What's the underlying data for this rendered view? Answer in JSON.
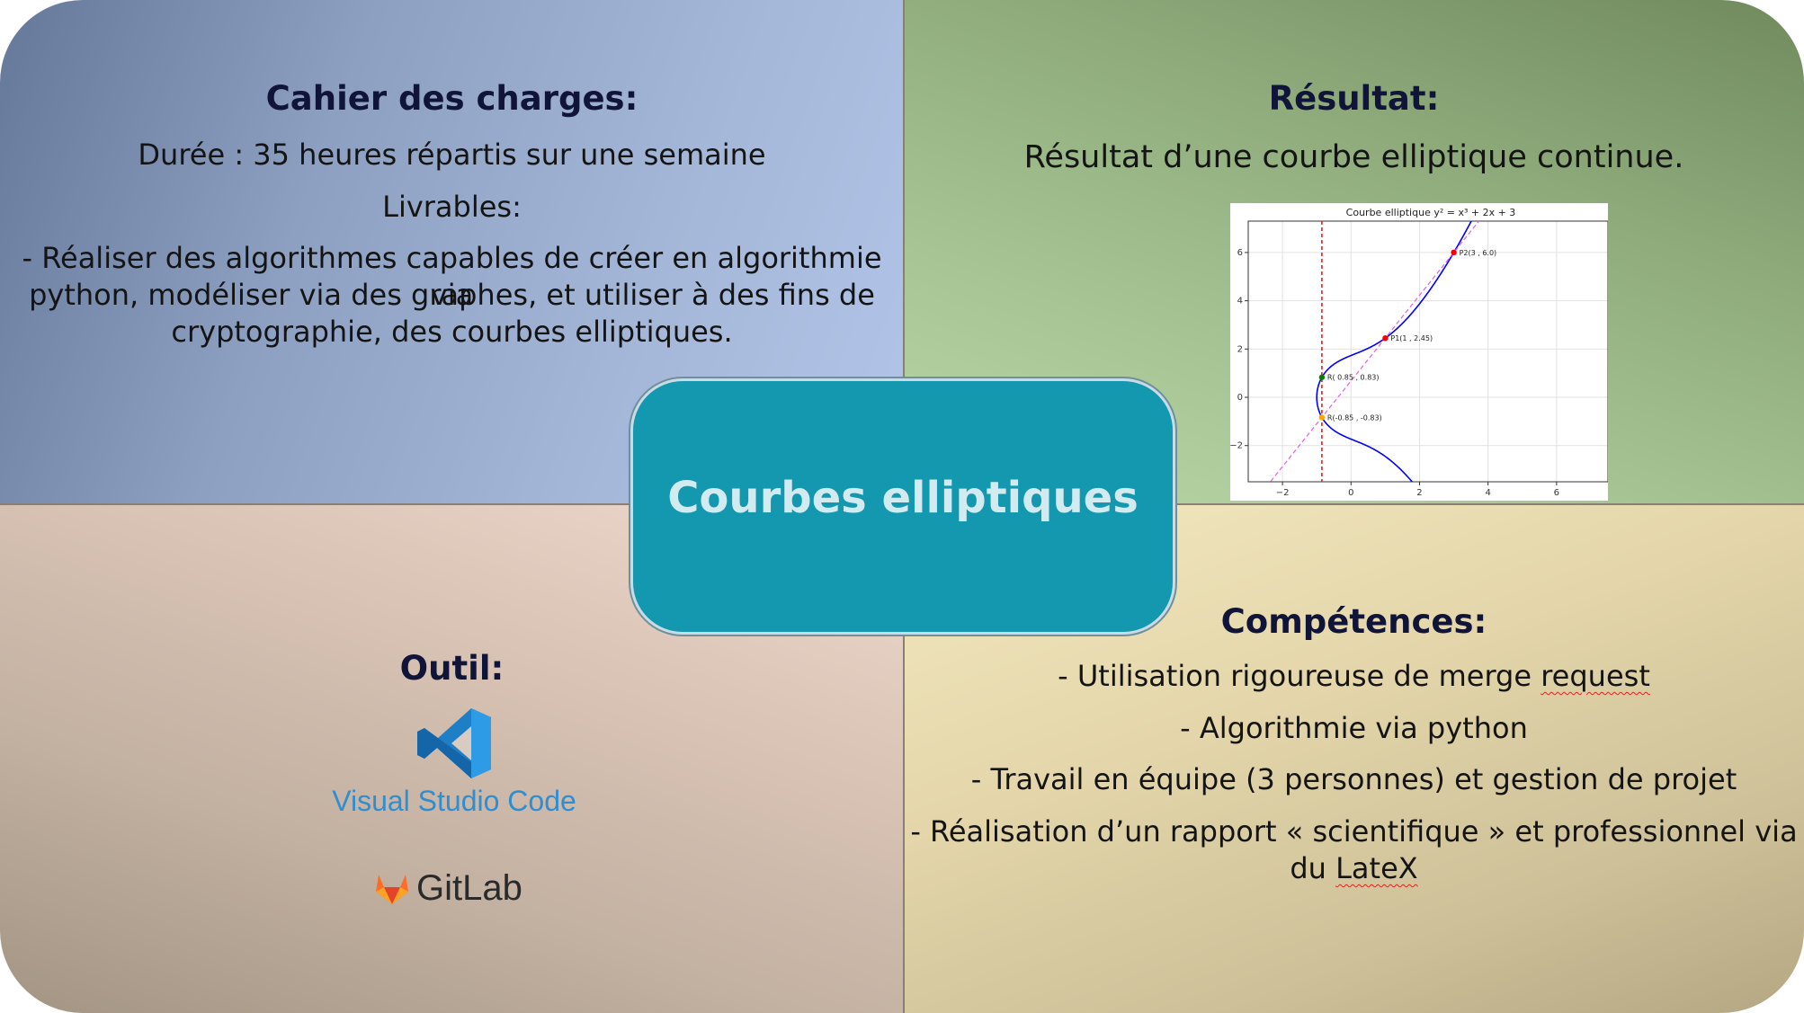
{
  "slide": {
    "title": "Courbes elliptiques",
    "colors": {
      "center_box": "#1398b0",
      "center_text": "#d2ebf1",
      "heading": "#101438",
      "vscode_blue": "#2f8ed0",
      "gitlab_orange": "#fc6d26"
    }
  },
  "cahier": {
    "heading": "Cahier des charges:",
    "duree": "Durée : 35 heures répartis sur une semaine",
    "livrables_label": "Livrables:",
    "livrables_line1": "- Réaliser des algorithmes capables de créer en algorithmie via",
    "livrables_line2": "python, modéliser via des graphes, et utiliser à des fins de",
    "livrables_line3": "cryptographie, des courbes elliptiques."
  },
  "resultat": {
    "heading": "Résultat:",
    "text": "Résultat d’une courbe elliptique continue."
  },
  "outil": {
    "heading": "Outil:",
    "tools": [
      {
        "name": "Visual Studio Code",
        "icon": "vscode-logo-icon"
      },
      {
        "name": "GitLab",
        "icon": "gitlab-logo-icon"
      }
    ]
  },
  "competences": {
    "heading": "Compétences:",
    "items": [
      {
        "prefix": "- Utilisation rigoureuse de merge ",
        "flagged": "request",
        "suffix": ""
      },
      {
        "prefix": "- Algorithmie via python",
        "flagged": "",
        "suffix": ""
      },
      {
        "prefix": "- Travail en équipe (3 personnes) et gestion de projet",
        "flagged": "",
        "suffix": ""
      },
      {
        "prefix": "- Réalisation d’un rapport « scientifique » et professionnel via",
        "flagged": "",
        "suffix": ""
      },
      {
        "prefix": "du ",
        "flagged": "LateX",
        "suffix": ""
      }
    ]
  },
  "chart_data": {
    "type": "line",
    "title": "Courbe elliptique y² = x³ + 2x + 3",
    "xlabel": "",
    "ylabel": "",
    "xlim": [
      -3,
      7.5
    ],
    "ylim": [
      -3.5,
      7.3
    ],
    "xticks": [
      -2,
      0,
      2,
      4,
      6
    ],
    "yticks": [
      -2,
      0,
      2,
      4,
      6
    ],
    "xtick_labels": [
      "−2",
      "0",
      "2",
      "4",
      "6"
    ],
    "ytick_labels": [
      "−2",
      "0",
      "2",
      "4",
      "6"
    ],
    "grid": true,
    "series": [
      {
        "kind": "curve",
        "equation": "y² = x³ + 2x + 3",
        "color": "#0000ff"
      },
      {
        "kind": "secant_line",
        "through": [
          [
            -0.85,
            -0.83
          ],
          [
            3,
            6.0
          ]
        ],
        "color": "#e060e0",
        "style": "dashed"
      },
      {
        "kind": "vertical_line",
        "x": -0.85,
        "color": "#e02020",
        "style": "dashed"
      }
    ],
    "points": [
      {
        "label": "P2(3 , 6.0)",
        "x": 3,
        "y": 6.0,
        "color": "#ff0000"
      },
      {
        "label": "P1(1 , 2.45)",
        "x": 1,
        "y": 2.45,
        "color": "#ff0000"
      },
      {
        "label": "R( 0.85 , 0.83)",
        "x": -0.85,
        "y": 0.83,
        "color": "#008000"
      },
      {
        "label": "R(-0.85 , -0.83)",
        "x": -0.85,
        "y": -0.83,
        "color": "#ffa500"
      }
    ]
  }
}
